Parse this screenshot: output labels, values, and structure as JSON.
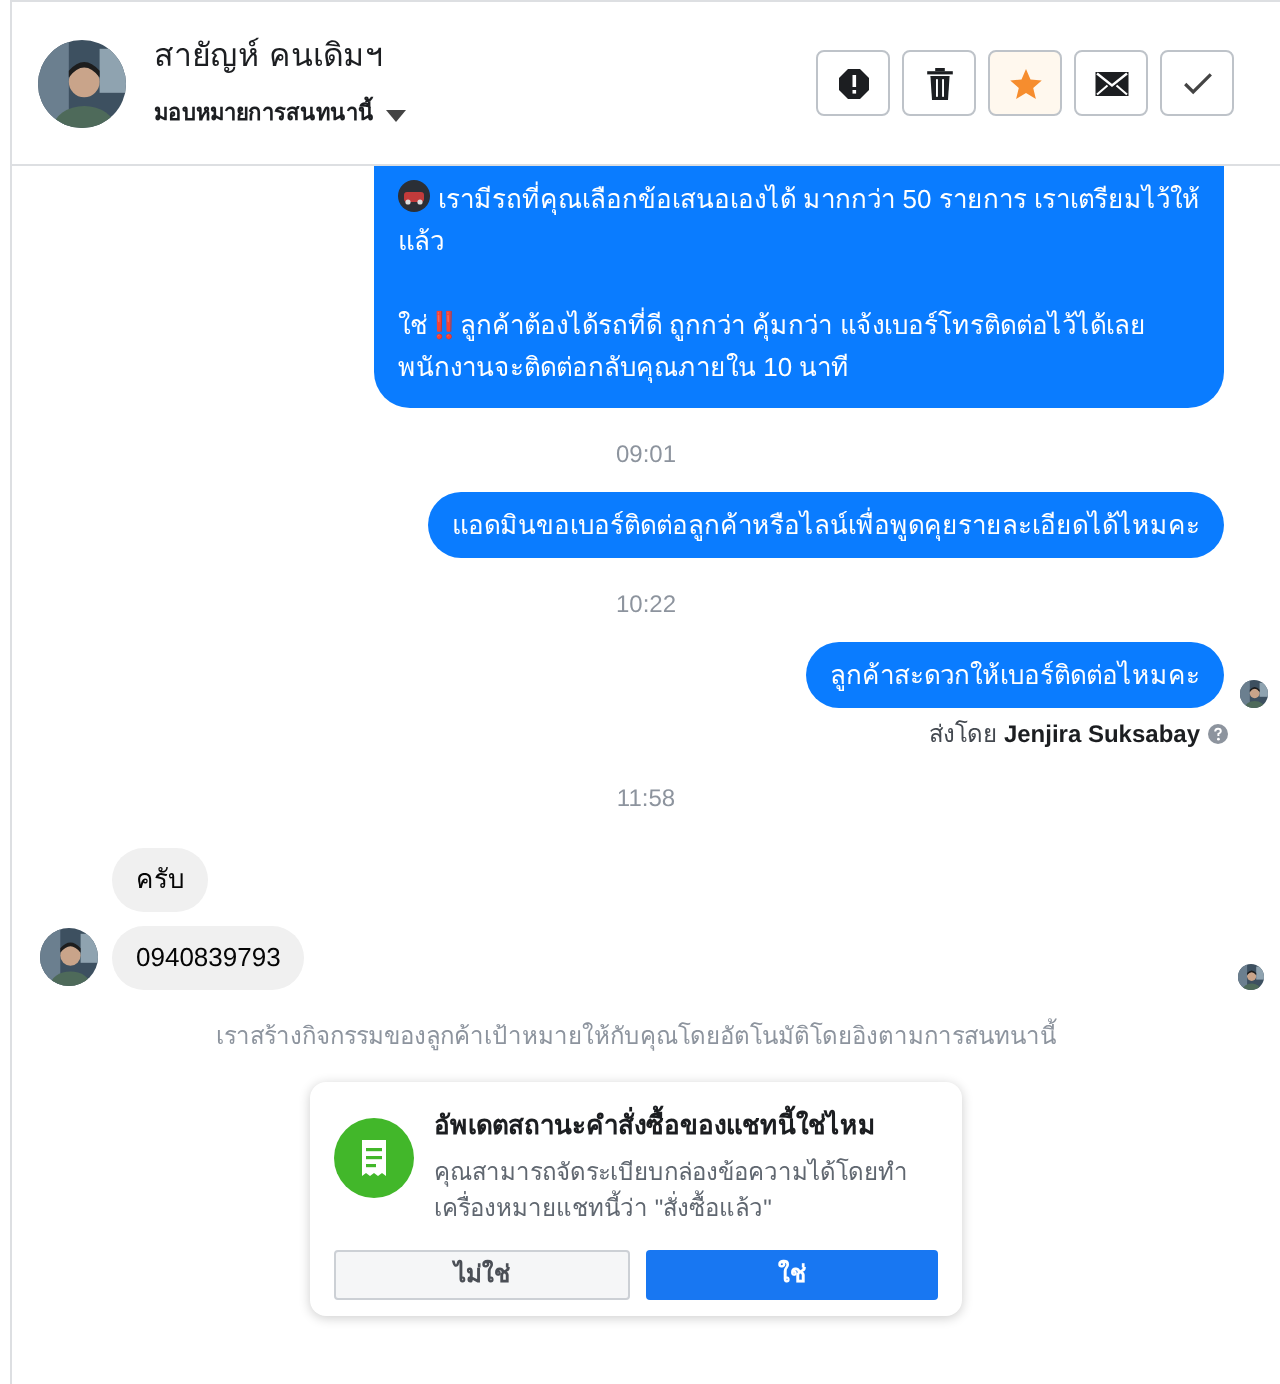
{
  "header": {
    "contact_name": "สายัญห์ คนเดิมฯ",
    "assign_label": "มอบหมายการสนทนานี้",
    "actions": [
      {
        "kind": "spam",
        "selected": false
      },
      {
        "kind": "delete",
        "selected": false
      },
      {
        "kind": "star",
        "selected": true
      },
      {
        "kind": "unread",
        "selected": false
      },
      {
        "kind": "done",
        "selected": false
      }
    ]
  },
  "messages": [
    {
      "kind": "outgoing",
      "lines": [
        {
          "kind": "car_line",
          "text": "เรามีรถที่คุณเลือกข้อเสนอเองได้ มากกว่า 50 รายการ เราเตรียมไว้ให้แล้ว"
        },
        {
          "kind": "plain",
          "text": "ใช่‼️ลูกค้าต้องได้รถที่ดี ถูกกว่า คุ้มกว่า แจ้งเบอร์โทรติดต่อไว้ได้เลย พนักงานจะติดต่อกลับคุณภายใน 10 นาที"
        }
      ]
    },
    {
      "kind": "time",
      "text": "09:01"
    },
    {
      "kind": "outgoing",
      "lines": [
        {
          "kind": "plain",
          "text": "แอดมินขอเบอร์ติดต่อลูกค้าหรือไลน์เพื่อพูดคุยรายละเอียดได้ไหมคะ"
        }
      ]
    },
    {
      "kind": "time",
      "text": "10:22"
    },
    {
      "kind": "outgoing",
      "seen": true,
      "lines": [
        {
          "kind": "plain",
          "text": "ลูกค้าสะดวกให้เบอร์ติดต่อไหมคะ"
        }
      ]
    },
    {
      "kind": "sender",
      "text": "ส่งโดย **Jenjira Suksabay**"
    },
    {
      "kind": "time",
      "text": "11:58"
    },
    {
      "kind": "incoming",
      "text": "ครับ",
      "avatar": false
    },
    {
      "kind": "incoming",
      "text": "0940839793",
      "avatar": true,
      "seen": true
    },
    {
      "kind": "note",
      "text": "เราสร้างกิจกรรมของลูกค้าเป้าหมายให้กับคุณโดยอัตโนมัติโดยอิงตามการสนทนานี้"
    }
  ],
  "prompt_card": {
    "title": "อัพเดตสถานะคำสั่งซื้อของแชทนี้ใช่ไหม",
    "body": "คุณสามารถจัดระเบียบกล่องข้อความได้โดยทำเครื่องหมายแชทนี้ว่า \"สั่งซื้อแล้ว\"",
    "buttons": [
      {
        "label": "ไม่ใช่",
        "kind": "secondary"
      },
      {
        "label": "ใช่",
        "kind": "primary"
      }
    ]
  }
}
